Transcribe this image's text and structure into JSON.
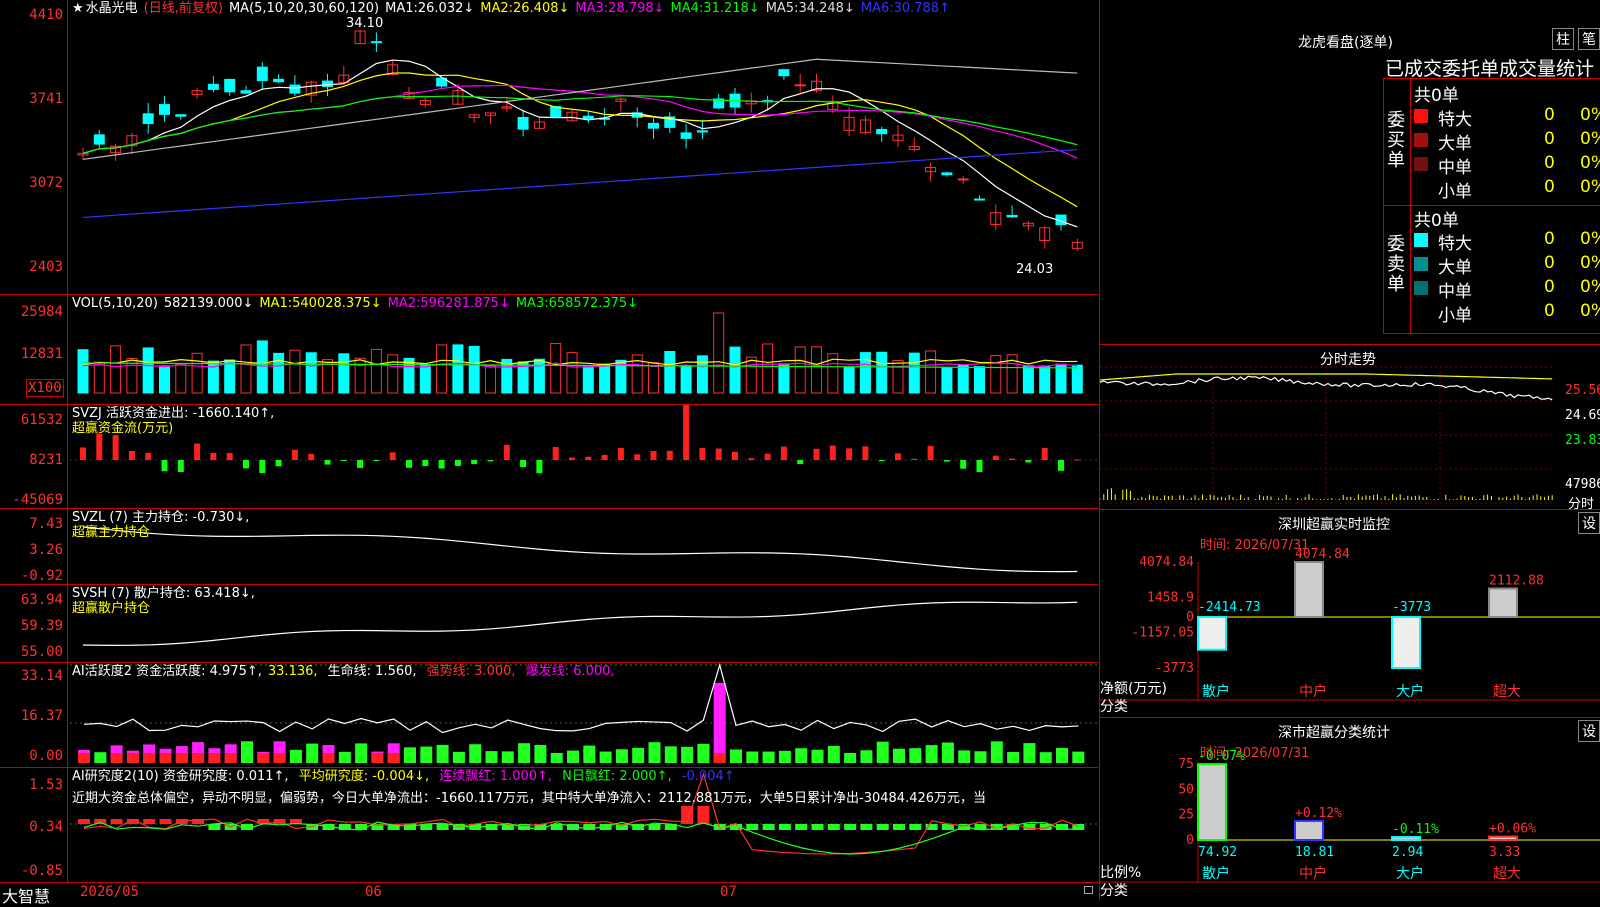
{
  "stock": {
    "name": "水晶光电",
    "mode": "(日线,前复权)",
    "star": "★"
  },
  "main": {
    "ma_label": "MA(5,10,20,30,60,120)",
    "ma": [
      {
        "k": "MA1:",
        "v": "26.032↓",
        "c": "#fff"
      },
      {
        "k": "MA2:",
        "v": "26.408↓",
        "c": "#ff0"
      },
      {
        "k": "MA3:",
        "v": "28.798↓",
        "c": "#f0f"
      },
      {
        "k": "MA4:",
        "v": "31.218↓",
        "c": "#0f0"
      },
      {
        "k": "MA5:",
        "v": "34.248↓",
        "c": "#ddd"
      },
      {
        "k": "MA6:",
        "v": "30.788↑",
        "c": "#33f"
      }
    ],
    "y_labels": [
      "4410",
      "3741",
      "3072",
      "2403"
    ],
    "high_label": "34.10",
    "low_label": "24.03"
  },
  "vol": {
    "label": "VOL(5,10,20)",
    "v": "582139.000↓",
    "ma": [
      {
        "k": "MA1:",
        "v": "540028.375↓",
        "c": "#ff0"
      },
      {
        "k": "MA2:",
        "v": "596281.875↓",
        "c": "#f0f"
      },
      {
        "k": "MA3:",
        "v": "658572.375↓",
        "c": "#0f0"
      }
    ],
    "y_labels": [
      "25984",
      "12831"
    ],
    "unit": "X100"
  },
  "svzj": {
    "label": "SVZJ  活跃资金进出: -1660.140↑,",
    "sub": "超赢资金流(万元)",
    "y_labels": [
      "61532",
      "8231",
      "-45069"
    ]
  },
  "svzl": {
    "label": "SVZL (7) 主力持仓: -0.730↓,",
    "sub": "超赢主力持仓",
    "y_labels": [
      "7.43",
      "3.26",
      "-0.92"
    ]
  },
  "svsh": {
    "label": "SVSH (7) 散户持仓: 63.418↓,",
    "sub": "超赢散户持仓",
    "y_labels": [
      "63.94",
      "59.39",
      "55.00"
    ]
  },
  "ai1": {
    "parts": [
      {
        "t": "AI活跃度2 资金活跃度: 4.975↑,",
        "c": "#fff"
      },
      {
        "t": "33.136,",
        "c": "#ff0"
      },
      {
        "t": " 生命线: 1.560,",
        "c": "#fff"
      },
      {
        "t": " 强势线: 3.000,",
        "c": "#f33"
      },
      {
        "t": " 爆发线: 6.000,",
        "c": "#f0f"
      }
    ],
    "y_labels": [
      "33.14",
      "16.37",
      "0.00"
    ]
  },
  "ai2": {
    "parts": [
      {
        "t": "AI研究度2(10) 资金研究度: 0.011↑,",
        "c": "#fff"
      },
      {
        "t": " 平均研究度: -0.004↓,",
        "c": "#ff0"
      },
      {
        "t": " 连续飘红: 1.000↑,",
        "c": "#f0f"
      },
      {
        "t": " N日飘红: 2.000↑,",
        "c": "#0f0"
      },
      {
        "t": " -0.004↑",
        "c": "#33f"
      }
    ],
    "text": "近期大资金总体偏空，异动不明显，偏弱势，今日大单净流出：-1660.117万元，其中特大单净流入：2112.881万元，大单5日累计净出-30484.426万元，当",
    "y_labels": [
      "1.53",
      "0.34",
      "-0.85"
    ]
  },
  "xaxis": {
    "brand": "大智慧",
    "labels": [
      "2026/05",
      "06",
      "07"
    ]
  },
  "longhu": {
    "title": "龙虎看盘(逐单)",
    "btn1": "柱",
    "btn2": "笔",
    "header": "已成交委托单成交量统计",
    "buy_side": "委买单",
    "sell_side": "委卖单",
    "buy_total": "共0单",
    "sell_total": "共0单",
    "buy_rows": [
      {
        "name": "特大",
        "n": "0",
        "p": "0%",
        "c": "#ff1010"
      },
      {
        "name": "大单",
        "n": "0",
        "p": "0%",
        "c": "#a01010"
      },
      {
        "name": "中单",
        "n": "0",
        "p": "0%",
        "c": "#701010"
      },
      {
        "name": "小单",
        "n": "0",
        "p": "0%",
        "c": ""
      }
    ],
    "sell_rows": [
      {
        "name": "特大",
        "n": "0",
        "p": "0%",
        "c": "#00ffff"
      },
      {
        "name": "大单",
        "n": "0",
        "p": "0%",
        "c": "#009090"
      },
      {
        "name": "中单",
        "n": "0",
        "p": "0%",
        "c": "#007070"
      },
      {
        "name": "小单",
        "n": "0",
        "p": "0%",
        "c": ""
      }
    ]
  },
  "intraday": {
    "title": "分时走势",
    "labels": [
      "25.56",
      "24.69",
      "23.83",
      "47986"
    ],
    "foot": "分时"
  },
  "monitor": {
    "title": "深圳超赢实时监控",
    "btn": "设",
    "time": "时间: 2026/07/31",
    "y_labels": [
      "4074.84",
      "1458.9",
      "0",
      "-1157.05",
      "-3773"
    ],
    "foot1": "净额(万元)",
    "foot2": "分类",
    "cats": [
      "散户",
      "中户",
      "大户",
      "超大"
    ],
    "chart_data": {
      "type": "bar",
      "categories": [
        "散户",
        "中户",
        "大户",
        "超大"
      ],
      "values": [
        -2414.73,
        4074.84,
        -3773,
        2112.88
      ],
      "labels": [
        "-2414.73",
        "4074.84",
        "-3773",
        "2112.88"
      ],
      "ylim": [
        -3773,
        4074.84
      ]
    }
  },
  "classify": {
    "title": "深市超赢分类统计",
    "btn": "设",
    "time": "时间: 2026/07/31",
    "y_labels": [
      "75",
      "50",
      "25",
      "0"
    ],
    "foot1": "比例%",
    "foot2": "分类",
    "cats": [
      "散户",
      "中户",
      "大户",
      "超大"
    ],
    "chart_data": {
      "type": "bar",
      "categories": [
        "散户",
        "中户",
        "大户",
        "超大"
      ],
      "values": [
        74.92,
        18.81,
        2.94,
        3.33
      ],
      "changes": [
        "-0.07%",
        "+0.12%",
        "-0.11%",
        "+0.06%"
      ],
      "ylim": [
        0,
        75
      ]
    }
  }
}
